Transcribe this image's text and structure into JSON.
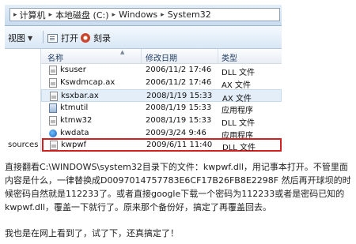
{
  "explorer": {
    "breadcrumb": [
      "计算机",
      "本地磁盘 (C:)",
      "Windows",
      "System32"
    ],
    "toolbar": {
      "view_label": "视图",
      "open_label": "打开",
      "burn_label": "刻录"
    },
    "navpane_text": "sources",
    "columns": {
      "name": "名称",
      "date": "修改日期",
      "type": "类型"
    },
    "files": [
      {
        "name": "ksuser",
        "date": "2006/11/2 17:46",
        "type": "DLL 文件",
        "icon": "dll"
      },
      {
        "name": "Kswdmcap.ax",
        "date": "2006/11/2 17:46",
        "type": "AX 文件",
        "icon": "dll"
      },
      {
        "name": "ksxbar.ax",
        "date": "2008/1/19 15:33",
        "type": "AX 文件",
        "icon": "dll"
      },
      {
        "name": "ktmutil",
        "date": "2008/1/19 15:33",
        "type": "应用程序",
        "icon": "exe"
      },
      {
        "name": "ktmw32",
        "date": "2008/1/19 15:33",
        "type": "DLL 文件",
        "icon": "dll"
      },
      {
        "name": "kwdata",
        "date": "2009/3/24 9:46",
        "type": "应用程序",
        "icon": "kw"
      }
    ],
    "highlighted_file": {
      "name": "kwpwf",
      "date": "2009/6/11 11:40",
      "type": "DLL 文件"
    },
    "highlight_color": "#d22020"
  },
  "article": {
    "paragraph1": "直接翻看C:\\WINDOWS\\system32目录下的文件：kwpwf.dll，用记事本打开。不管里面内容是什么，一律替换成D0097014757783E6CF17B26FB8E2298F 然后再开球坝的时候密码自然就是112233了。或者直接google下载一个密码为112233或者是密码已知的kwpwf.dll，覆盖一下就行了。原来那个备份好，搞定了再覆盖回去。",
    "paragraph2": "我也是在网上看到了，试了下，还真搞定了！"
  }
}
